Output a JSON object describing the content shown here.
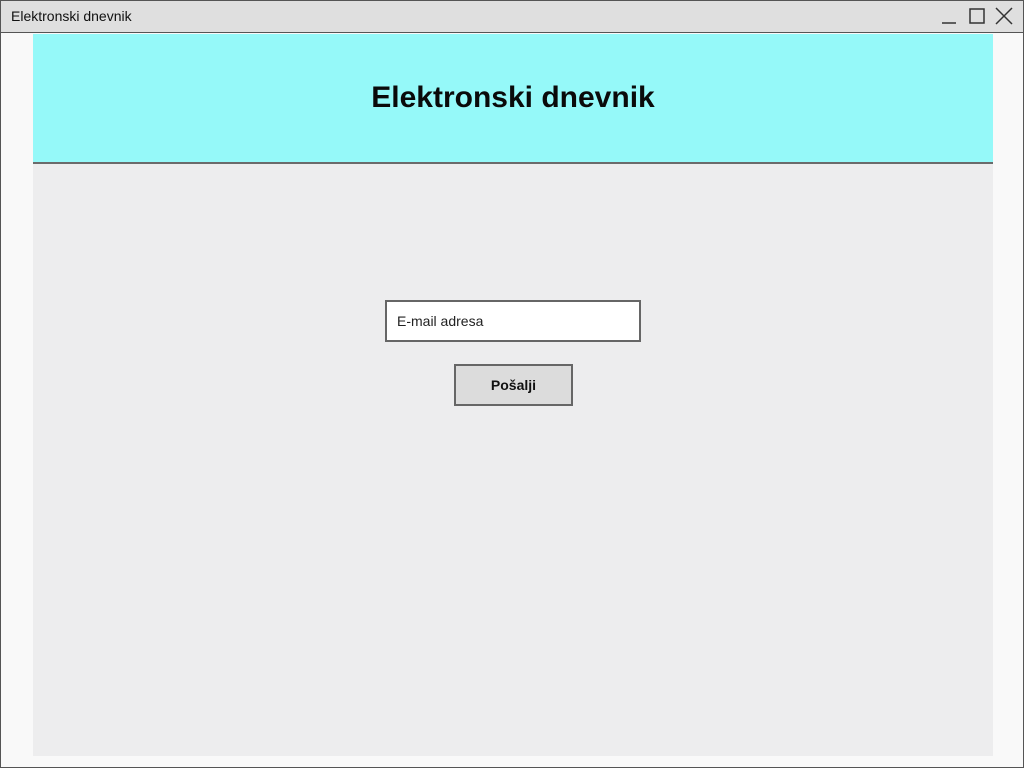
{
  "window": {
    "title": "Elektronski dnevnik",
    "controls": {
      "minimize_icon": "minimize-icon",
      "maximize_icon": "maximize-icon",
      "close_icon": "close-icon"
    }
  },
  "header": {
    "title": "Elektronski dnevnik",
    "background_color": "#95f9f9"
  },
  "form": {
    "email": {
      "placeholder": "E-mail adresa",
      "value": ""
    },
    "submit_label": "Pošalji"
  }
}
